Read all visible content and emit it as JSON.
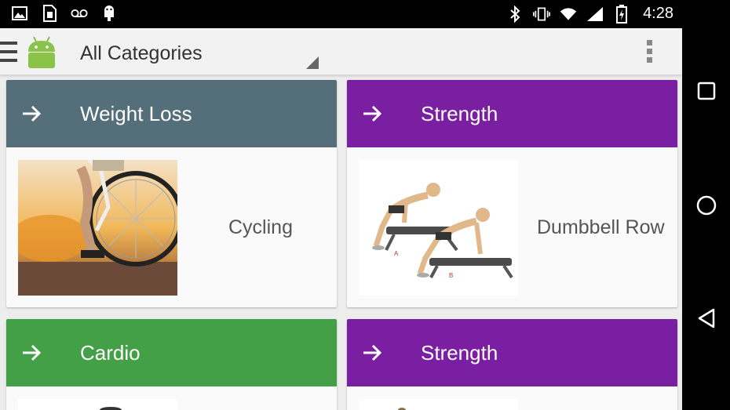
{
  "status_bar": {
    "left_icons": [
      "image-icon",
      "sim-icon",
      "voicemail-icon",
      "android-debug-icon"
    ],
    "right_icons": [
      "bluetooth-icon",
      "vibrate-icon",
      "wifi-icon",
      "signal-icon",
      "battery-icon"
    ],
    "time": "4:28"
  },
  "action_bar": {
    "spinner_value": "All Categories"
  },
  "cards": [
    {
      "category": "Weight Loss",
      "item": "Cycling",
      "header_color": "#546e7a",
      "thumb": "cycling-photo"
    },
    {
      "category": "Strength",
      "item": "Dumbbell Row",
      "header_color": "#7b1fa2",
      "thumb": "dumbbell-row-photo"
    },
    {
      "category": "Cardio",
      "item": "",
      "header_color": "#43a047",
      "thumb": "cardio-photo"
    },
    {
      "category": "Strength",
      "item": "",
      "header_color": "#7b1fa2",
      "thumb": "strength-photo"
    }
  ],
  "nav_bar": {
    "buttons": [
      "recents-button",
      "home-button",
      "back-button"
    ]
  }
}
